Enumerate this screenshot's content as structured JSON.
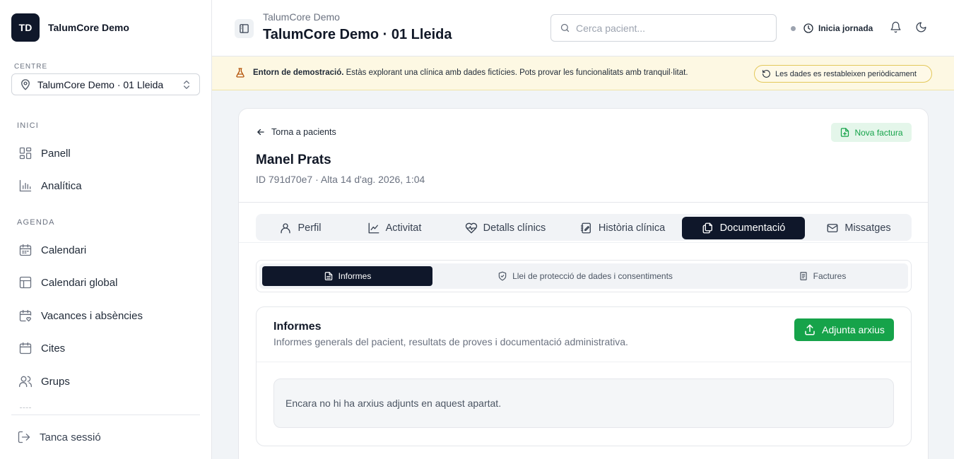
{
  "sidebar": {
    "logo": "TD",
    "brand": "TalumCore Demo",
    "centre_label": "CENTRE",
    "centre_value": "TalumCore Demo · 01 Lleida",
    "sections": [
      {
        "title": "INICI",
        "items": [
          {
            "label": "Panell",
            "icon": "grid-icon"
          },
          {
            "label": "Analítica",
            "icon": "bar-chart-icon"
          }
        ]
      },
      {
        "title": "AGENDA",
        "items": [
          {
            "label": "Calendari",
            "icon": "calendar-icon"
          },
          {
            "label": "Calendari global",
            "icon": "layout-icon"
          },
          {
            "label": "Vacances i absències",
            "icon": "calendar-heart-icon"
          },
          {
            "label": "Cites",
            "icon": "calendar-blank-icon"
          },
          {
            "label": "Grups",
            "icon": "users-icon"
          }
        ]
      }
    ],
    "logout": "Tanca sessió"
  },
  "header": {
    "subtitle": "TalumCore Demo",
    "title": "TalumCore Demo · 01 Lleida",
    "search_placeholder": "Cerca pacient...",
    "jornada": "Inicia jornada"
  },
  "banner": {
    "title": "Entorn de demostració.",
    "text": " Estàs explorant una clínica amb dades fictícies. Pots provar les funcionalitats amb tranquil·litat.",
    "pill": "Les dades es restableixen periòdicament"
  },
  "patient": {
    "back": "Torna a pacients",
    "new_invoice": "Nova factura",
    "name": "Manel Prats",
    "meta": "ID 791d70e7 · Alta 14 d'ag. 2026, 1:04"
  },
  "tabs": [
    {
      "label": "Perfil",
      "icon": "user-icon",
      "active": false
    },
    {
      "label": "Activitat",
      "icon": "activity-icon",
      "active": false
    },
    {
      "label": "Detalls clínics",
      "icon": "heart-pulse-icon",
      "active": false
    },
    {
      "label": "Història clínica",
      "icon": "notebook-icon",
      "active": false
    },
    {
      "label": "Documentació",
      "icon": "files-icon",
      "active": true
    },
    {
      "label": "Missatges",
      "icon": "mail-icon",
      "active": false
    }
  ],
  "subtabs": [
    {
      "label": "Informes",
      "icon": "file-text-icon",
      "active": true
    },
    {
      "label": "Llei de protecció de dades i consentiments",
      "icon": "shield-icon",
      "active": false
    },
    {
      "label": "Factures",
      "icon": "receipt-icon",
      "active": false
    }
  ],
  "panel": {
    "title": "Informes",
    "description": "Informes generals del pacient, resultats de proves i documentació administrativa.",
    "attach": "Adjunta arxius",
    "empty": "Encara no hi ha arxius adjunts en aquest apartat."
  },
  "colors": {
    "primary_dark": "#0f172a",
    "accent_green": "#16a34a",
    "banner_bg": "#fdf8e3"
  }
}
